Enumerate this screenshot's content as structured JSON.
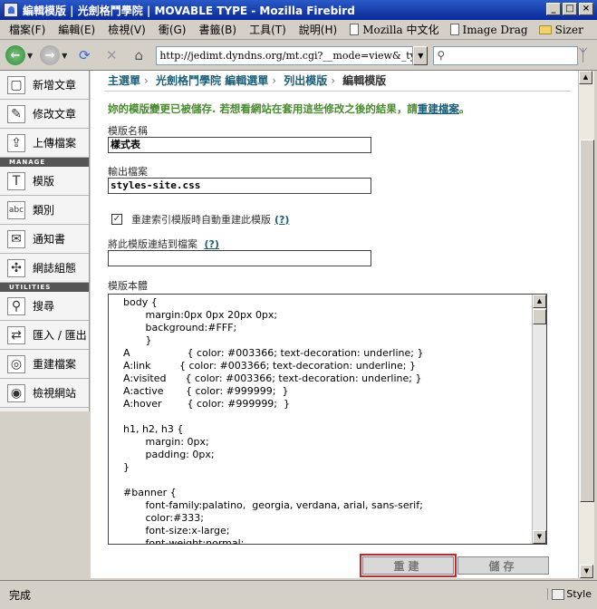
{
  "window": {
    "title": "編輯模版 | 光劍格鬥學院 | MOVABLE TYPE - Mozilla Firebird",
    "controls": [
      "_",
      "□",
      "×"
    ]
  },
  "menubar": {
    "items": [
      "檔案(F)",
      "編輯(E)",
      "檢視(V)",
      "衝(G)",
      "書籤(B)",
      "工具(T)",
      "說明(H)"
    ],
    "bookmarks": [
      "Mozilla 中文化",
      "Image Drag",
      "Sizer"
    ]
  },
  "navbar": {
    "url": "http://jedimt.dyndns.org/mt.cgi?__mode=view&_ty",
    "search_value": ""
  },
  "sidebar": {
    "items_top": [
      {
        "label": "新增文章",
        "icon": "new-document-icon",
        "glyph": "▢"
      },
      {
        "label": "修改文章",
        "icon": "edit-document-icon",
        "glyph": "✎"
      },
      {
        "label": "上傳檔案",
        "icon": "upload-icon",
        "glyph": "⇪"
      }
    ],
    "section_manage": "MANAGE",
    "items_manage": [
      {
        "label": "模版",
        "icon": "template-icon",
        "glyph": "T"
      },
      {
        "label": "類別",
        "icon": "category-icon",
        "glyph": "abc"
      },
      {
        "label": "通知書",
        "icon": "mail-icon",
        "glyph": "✉"
      },
      {
        "label": "網誌組態",
        "icon": "tools-icon",
        "glyph": "✣"
      }
    ],
    "section_utilities": "UTILITIES",
    "items_utilities": [
      {
        "label": "搜尋",
        "icon": "search-icon",
        "glyph": "⚲"
      },
      {
        "label": "匯入 / 匯出",
        "icon": "import-export-icon",
        "glyph": "⇄"
      },
      {
        "label": "重建檔案",
        "icon": "rebuild-icon",
        "glyph": "◎"
      },
      {
        "label": "檢視網站",
        "icon": "view-site-icon",
        "glyph": "◉"
      }
    ]
  },
  "breadcrumb": {
    "items": [
      "主選單",
      "光劍格鬥學院 編輯選單",
      "列出模版"
    ],
    "current": "編輯模版"
  },
  "message": {
    "text": "妳的模版變更已被儲存. 若想看網站在套用這些修改之後的結果，請",
    "link": "重建檔案",
    "end": "。"
  },
  "form": {
    "name_label": "模版名稱",
    "name_value": "樣式表",
    "output_label": "輸出檔案",
    "output_value": "styles-site.css",
    "rebuild_checkbox_label": "重建索引模版時自動重建此模版",
    "rebuild_checked": true,
    "help_link": "(?)",
    "link_label": "將此模版連結到檔案",
    "link_value": "",
    "body_label": "模版本體",
    "body_text": "body {\n       margin:0px 0px 20px 0px;\n       background:#FFF;\n       }\nA                  { color: #003366; text-decoration: underline; }\nA:link         { color: #003366; text-decoration: underline; }\nA:visited      { color: #003366; text-decoration: underline; }\nA:active       { color: #999999;  }\nA:hover        { color: #999999;  }\n\nh1, h2, h3 {\n       margin: 0px;\n       padding: 0px;\n}\n\n#banner {\n       font-family:palatino,  georgia, verdana, arial, sans-serif;\n       color:#333;\n       font-size:x-large;\n       font-weight:normal;"
  },
  "buttons": {
    "rebuild": "重建",
    "save": "儲存"
  },
  "status": {
    "text": "完成",
    "style_label": "Style"
  }
}
